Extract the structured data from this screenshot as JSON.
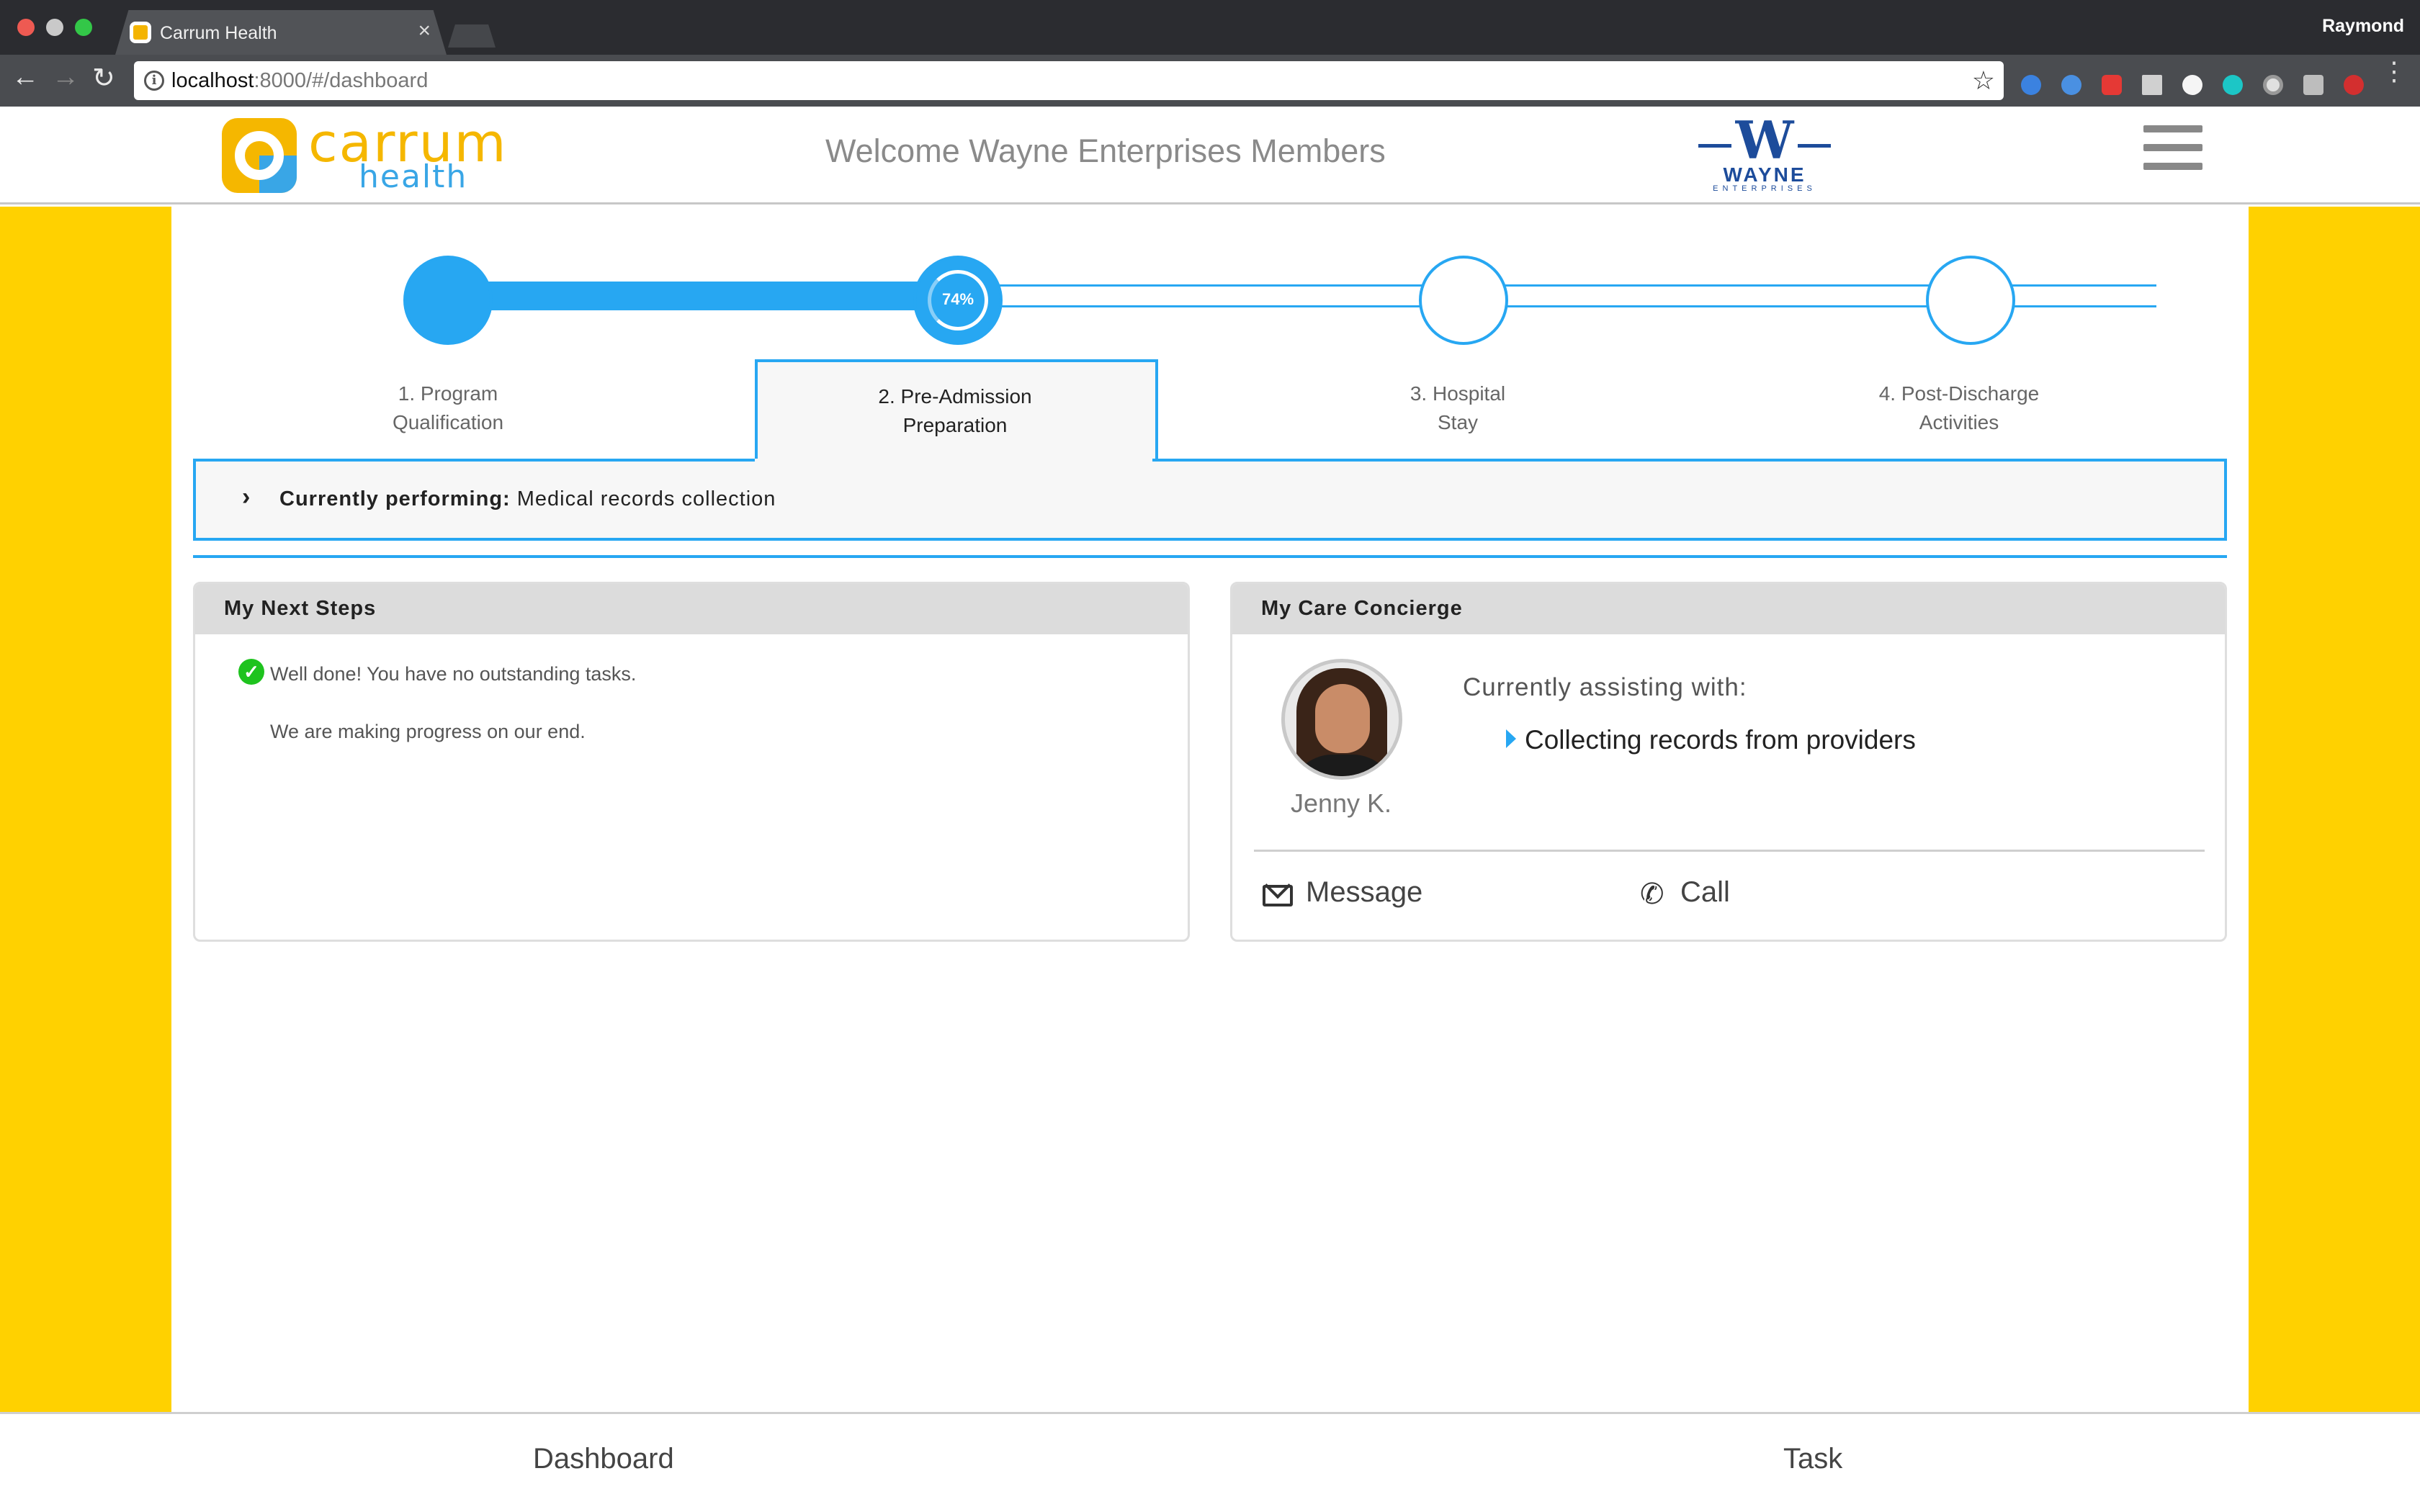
{
  "browser": {
    "tab_title": "Carrum Health",
    "tab_close": "×",
    "profile_name": "Raymond",
    "url_host": "localhost",
    "url_path": ":8000/#/dashboard",
    "back_glyph": "←",
    "forward_glyph": "→",
    "reload_glyph": "↻",
    "star_glyph": "☆",
    "menu_glyph": "⋮"
  },
  "header": {
    "logo_primary": "carrum",
    "logo_secondary": "health",
    "welcome": "Welcome Wayne Enterprises Members",
    "partner_logo_letter": "W",
    "partner_logo_name": "WAYNE",
    "partner_logo_sub": "ENTERPRISES"
  },
  "progress": {
    "current_step_percent": "74%",
    "current_step_fraction": 0.74,
    "steps": [
      {
        "label_line1": "1. Program",
        "label_line2": "Qualification",
        "state": "done"
      },
      {
        "label_line1": "2. Pre-Admission",
        "label_line2": "Preparation",
        "state": "current"
      },
      {
        "label_line1": "3. Hospital",
        "label_line2": "Stay",
        "state": "upcoming"
      },
      {
        "label_line1": "4. Post-Discharge",
        "label_line2": "Activities",
        "state": "upcoming"
      }
    ],
    "performing_label": "Currently performing:",
    "performing_value": "Medical records collection",
    "chevron": "›"
  },
  "next_steps": {
    "title": "My Next Steps",
    "status_message": "Well done! You have no outstanding tasks.",
    "progress_message": "We are making progress on our end.",
    "check_glyph": "✓"
  },
  "concierge": {
    "title": "My Care Concierge",
    "name": "Jenny K.",
    "assisting_label": "Currently assisting with:",
    "assisting_item": "Collecting records from providers",
    "message_label": "Message",
    "call_label": "Call",
    "phone_glyph": "✆"
  },
  "bottom_nav": {
    "items": [
      "Dashboard",
      "Task"
    ]
  },
  "colors": {
    "accent_blue": "#27a7f2",
    "side_yellow": "#ffd100",
    "brand_orange": "#f5b700",
    "brand_blue": "#39a6e6",
    "partner_blue": "#1d4c9b",
    "success_green": "#1ec31e"
  }
}
